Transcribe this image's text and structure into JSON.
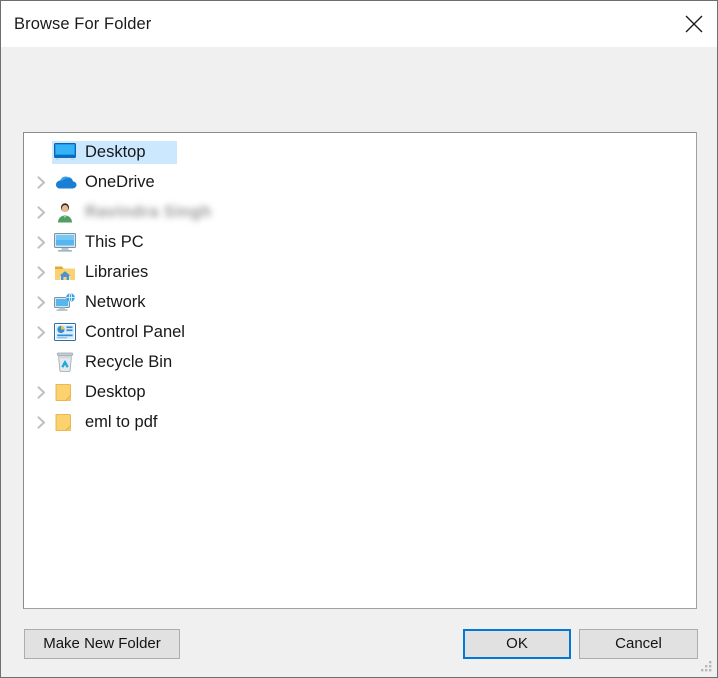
{
  "window": {
    "title": "Browse For Folder",
    "close_icon": "close-icon",
    "resize_grip": "resize-grip"
  },
  "tree": {
    "items": [
      {
        "label": "Desktop",
        "icon": "desktop-monitor-icon",
        "expandable": false,
        "selected": true,
        "redacted": false
      },
      {
        "label": "OneDrive",
        "icon": "onedrive-cloud-icon",
        "expandable": true,
        "selected": false,
        "redacted": false
      },
      {
        "label": "Ravindra Singh",
        "icon": "user-account-icon",
        "expandable": true,
        "selected": false,
        "redacted": true
      },
      {
        "label": "This PC",
        "icon": "this-pc-icon",
        "expandable": true,
        "selected": false,
        "redacted": false
      },
      {
        "label": "Libraries",
        "icon": "libraries-icon",
        "expandable": true,
        "selected": false,
        "redacted": false
      },
      {
        "label": "Network",
        "icon": "network-icon",
        "expandable": true,
        "selected": false,
        "redacted": false
      },
      {
        "label": "Control Panel",
        "icon": "control-panel-icon",
        "expandable": true,
        "selected": false,
        "redacted": false
      },
      {
        "label": "Recycle Bin",
        "icon": "recycle-bin-icon",
        "expandable": false,
        "selected": false,
        "redacted": false
      },
      {
        "label": "Desktop",
        "icon": "folder-icon",
        "expandable": true,
        "selected": false,
        "redacted": false
      },
      {
        "label": "eml to pdf",
        "icon": "folder-icon",
        "expandable": true,
        "selected": false,
        "redacted": false
      }
    ]
  },
  "buttons": {
    "make_new_folder": "Make New Folder",
    "ok": "OK",
    "cancel": "Cancel"
  },
  "colors": {
    "selection": "#cce8ff",
    "focus_border": "#0078d7",
    "dialog_background": "#f0f0f0",
    "panel_background": "#ffffff",
    "button_face": "#e1e1e1"
  }
}
